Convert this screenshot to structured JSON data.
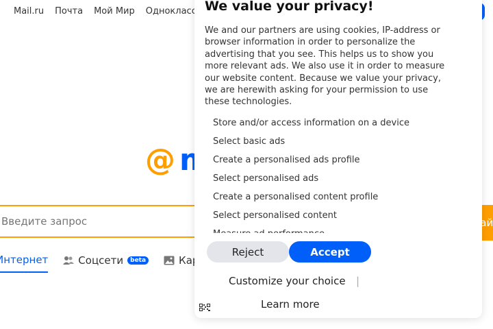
{
  "topnav": {
    "items": [
      "Mail.ru",
      "Почта",
      "Мой Мир",
      "Одноклассники"
    ]
  },
  "logo": {
    "at": "@",
    "rest": "m"
  },
  "search": {
    "placeholder": "Введите запрос",
    "button_label": "Найти"
  },
  "tabs": [
    {
      "label": "Интернет",
      "icon": "none",
      "active": true
    },
    {
      "label": "Соцсети",
      "icon": "people-icon",
      "badge": "beta"
    },
    {
      "label": "Картинки",
      "icon": "image-icon"
    }
  ],
  "consent": {
    "title": "We value your privacy!",
    "description": "We and our partners are using cookies, IP-address or browser information in order to personalize the advertising that you see. This helps us to show you more relevant ads. We also use it in order to measure our website content. Because we value your privacy, we are herewith asking for your permission to use these technologies.",
    "purposes": [
      "Store and/or access information on a device",
      "Select basic ads",
      "Create a personalised ads profile",
      "Select personalised ads",
      "Create a personalised content profile",
      "Select personalised content",
      "Measure ad performance"
    ],
    "reject_label": "Reject",
    "accept_label": "Accept",
    "customize_label": "Customize your choice",
    "separator": "|",
    "learn_more_label": "Learn more"
  },
  "colors": {
    "accent": "#005ff9",
    "brand_orange": "#ff9e00"
  }
}
